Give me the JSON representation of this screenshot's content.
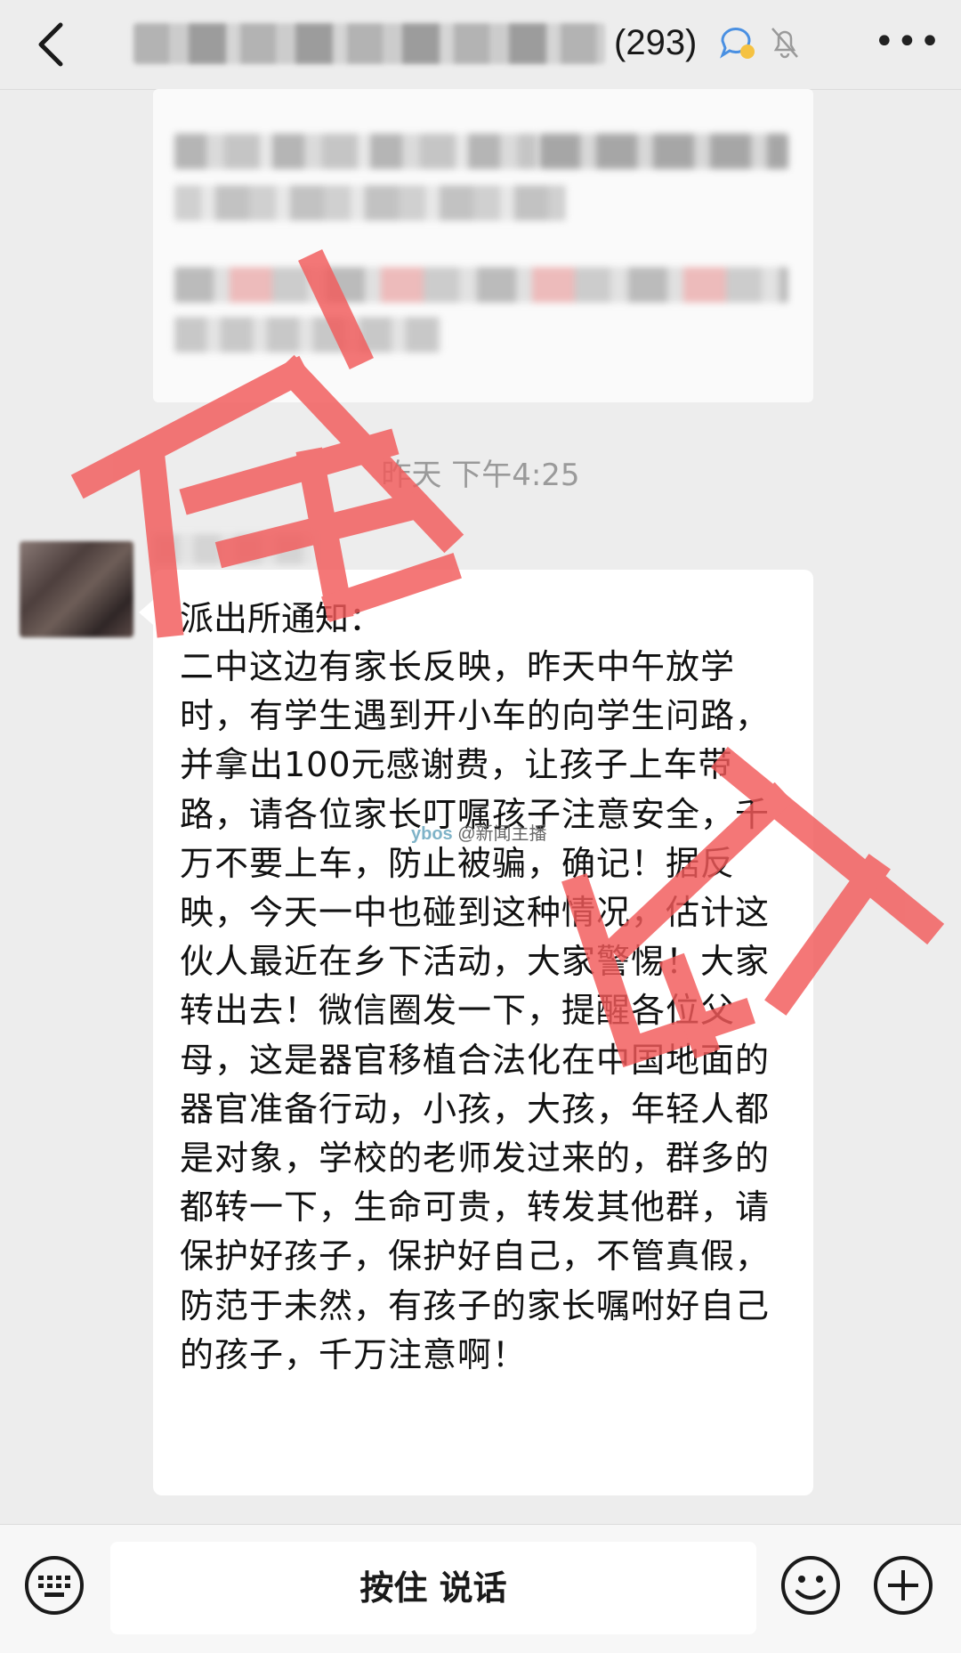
{
  "header": {
    "member_count": "(293)"
  },
  "chat": {
    "timestamp": "昨天 下午4:25",
    "message": {
      "title": "派出所通知：",
      "body": "二中这边有家长反映，昨天中午放学时，有学生遇到开小车的向学生问路，并拿出100元感谢费，让孩子上车带路，请各位家长叮嘱孩子注意安全，千万不要上车，防止被骗，确记！据反映，今天一中也碰到这种情况，估计这伙人最近在乡下活动，大家警惕！大家转出去！微信圈发一下，提醒各位父母，这是器官移植合法化在中国地面的器官准备行动，小孩，大孩，年轻人都是对象，学校的老师发过来的，群多的都转一下，生命可贵，转发其他群，请保护好孩子，保护好自己，不管真假，防范于未然，有孩子的家长嘱咐好自己的孩子，千万注意啊！"
    }
  },
  "watermark": {
    "logo": "ybos",
    "handle": "@新闻主播"
  },
  "stamp": {
    "text": "诈骗",
    "color": "#f25a5a"
  },
  "bottom_bar": {
    "voice_label": "按住 说话"
  },
  "icons": [
    "back-arrow-icon",
    "group-chat-badge-icon",
    "mute-bell-icon",
    "more-dots-icon",
    "keyboard-icon",
    "emoji-icon",
    "plus-icon"
  ]
}
